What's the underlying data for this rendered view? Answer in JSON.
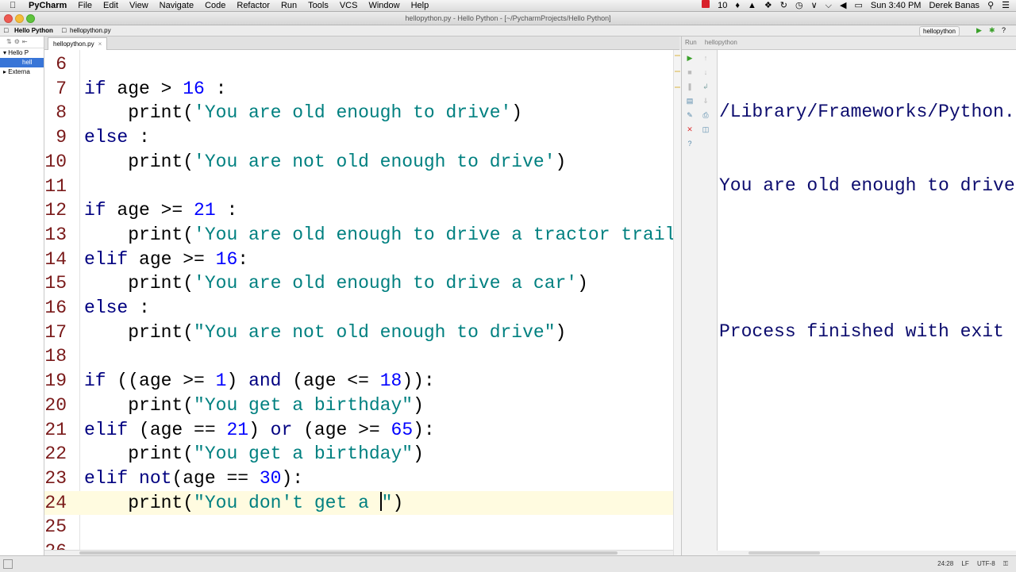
{
  "menubar": {
    "app": "PyCharm",
    "items": [
      "File",
      "Edit",
      "View",
      "Navigate",
      "Code",
      "Refactor",
      "Run",
      "Tools",
      "VCS",
      "Window",
      "Help"
    ],
    "status_num": "10",
    "clock": "Sun 3:40 PM",
    "user": "Derek Banas"
  },
  "window": {
    "title": "hellopython.py - Hello Python - [~/PycharmProjects/Hello Python]"
  },
  "navbar": {
    "project": "Hello Python",
    "file": "hellopython.py",
    "run_config": "hellopython"
  },
  "project_panel": {
    "root": "Hello P",
    "file": "hell",
    "external": "Externa"
  },
  "tab": {
    "label": "hellopython.py"
  },
  "editor": {
    "lines": [
      {
        "n": "6",
        "code": ""
      },
      {
        "n": "7",
        "code": "if age > 16 :"
      },
      {
        "n": "8",
        "code": "    print('You are old enough to drive')"
      },
      {
        "n": "9",
        "code": "else :"
      },
      {
        "n": "10",
        "code": "    print('You are not old enough to drive')"
      },
      {
        "n": "11",
        "code": ""
      },
      {
        "n": "12",
        "code": "if age >= 21 :"
      },
      {
        "n": "13",
        "code": "    print('You are old enough to drive a tractor trailer"
      },
      {
        "n": "14",
        "code": "elif age >= 16:"
      },
      {
        "n": "15",
        "code": "    print('You are old enough to drive a car')"
      },
      {
        "n": "16",
        "code": "else :"
      },
      {
        "n": "17",
        "code": "    print(\"You are not old enough to drive\")"
      },
      {
        "n": "18",
        "code": ""
      },
      {
        "n": "19",
        "code": "if ((age >= 1) and (age <= 18)):"
      },
      {
        "n": "20",
        "code": "    print(\"You get a birthday\")"
      },
      {
        "n": "21",
        "code": "elif (age == 21) or (age >= 65):"
      },
      {
        "n": "22",
        "code": "    print(\"You get a birthday\")"
      },
      {
        "n": "23",
        "code": "elif not(age == 30):"
      },
      {
        "n": "24",
        "code": "    print(\"You don't get a \")"
      },
      {
        "n": "25",
        "code": ""
      },
      {
        "n": "26",
        "code": ""
      }
    ],
    "current_line": "24"
  },
  "run_panel": {
    "header": "Run",
    "config": "hellopython",
    "output": [
      "/Library/Frameworks/Python.f",
      "You are old enough to drive",
      "",
      "Process finished with exit c"
    ]
  },
  "statusbar": {
    "position": "24:28",
    "line_sep": "LF",
    "encoding": "UTF-8"
  }
}
